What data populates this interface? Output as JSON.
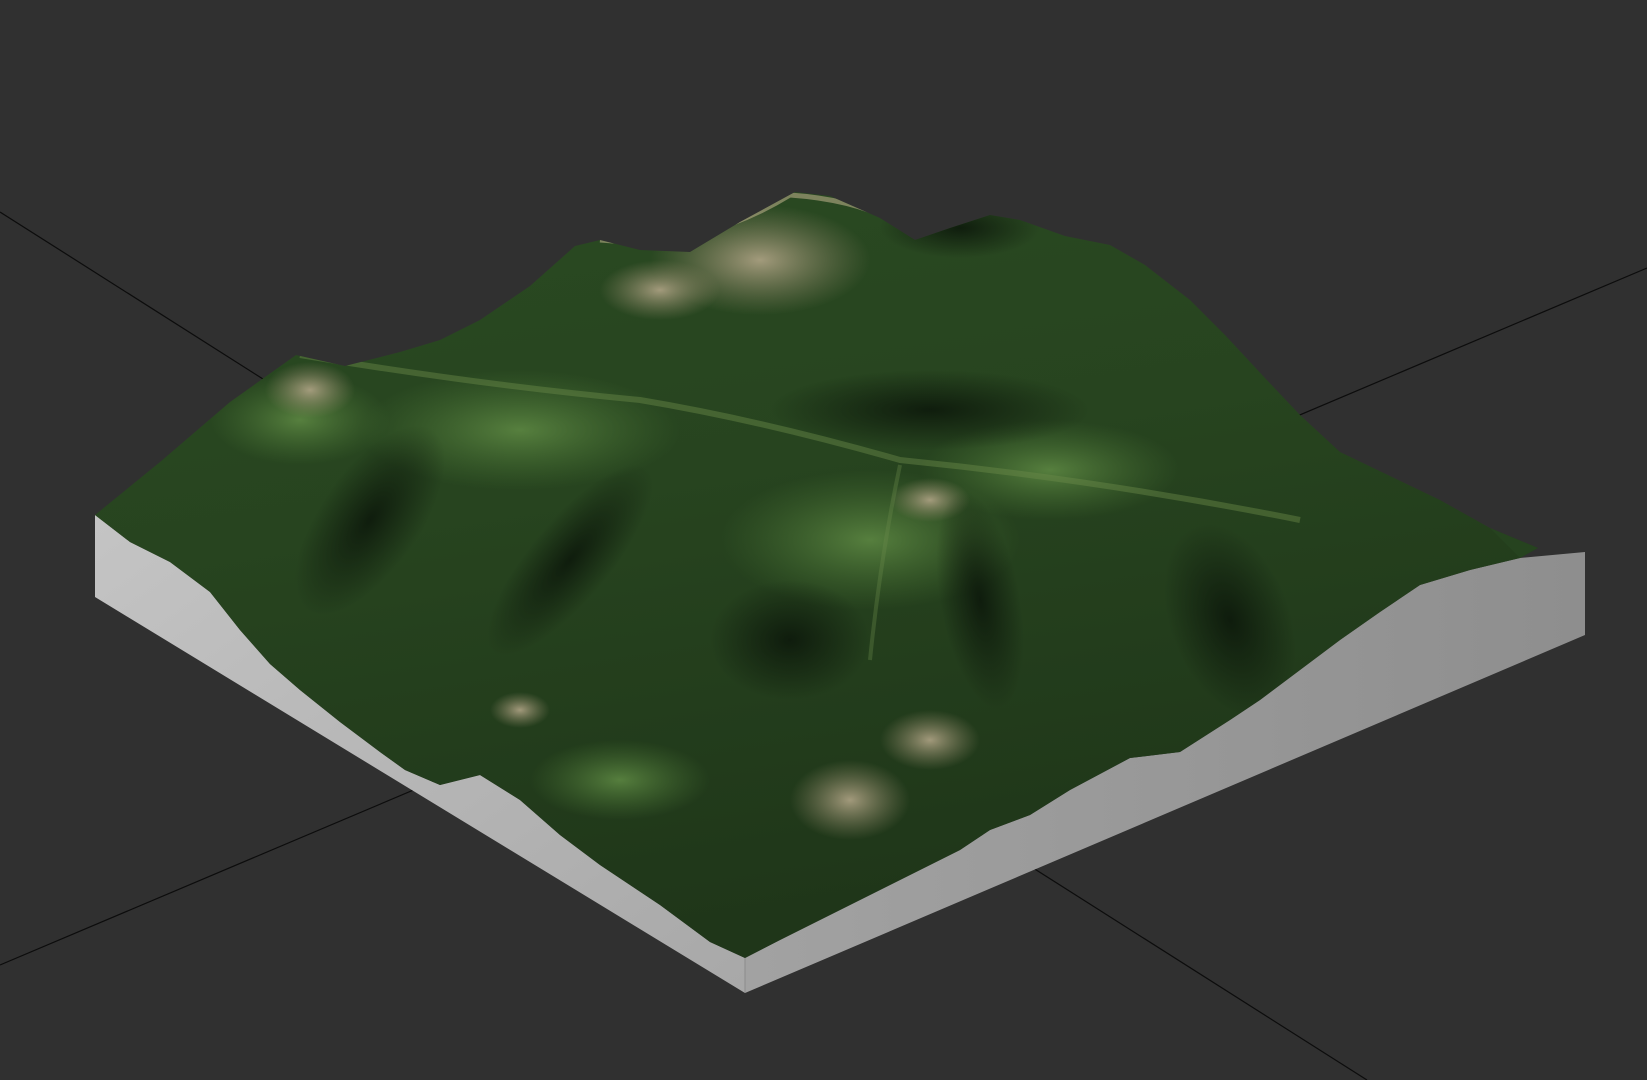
{
  "viewport": {
    "background_color": "#303030",
    "grid_axis_color": "#0c0c0c",
    "base_side_colors": [
      "#b4b4b4",
      "#9a9a9a"
    ],
    "terrain_palette": {
      "forest_dark": "#1c3318",
      "forest": "#2e5226",
      "meadow": "#4a7535",
      "rock": "#a39a7c",
      "shadow": "#0f1c0d"
    },
    "terrain_model": {
      "texture": "satellite-imagery",
      "has_solid_base": true
    }
  }
}
